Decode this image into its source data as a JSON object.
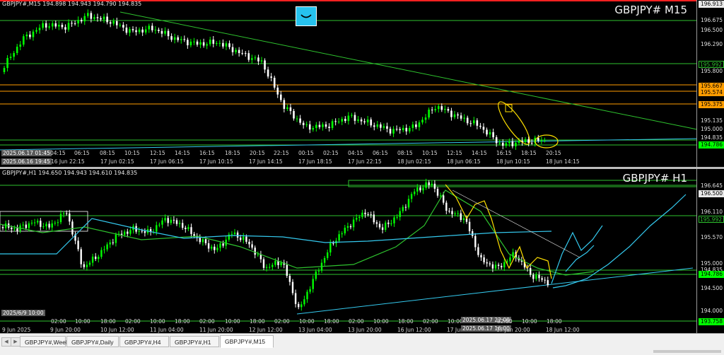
{
  "top_chart": {
    "header": "GBPJPY#,M15  194.898 194.943 194.790 194.835",
    "title": "GBPJPY# M15",
    "price_labels": [
      "196.913",
      "196.675",
      "196.500",
      "196.290",
      "195.992",
      "195.800",
      "195.667",
      "195.574",
      "195.375",
      "195.135",
      "195.000",
      "194.835",
      "194.786"
    ],
    "time_labels": [
      "04:15",
      "06:15",
      "08:15",
      "10:15",
      "12:15",
      "14:15",
      "16:15",
      "18:15",
      "20:15",
      "22:15",
      "00:15",
      "02:15",
      "04:15",
      "06:15",
      "08:15",
      "10:15",
      "12:15",
      "14:15",
      "16:15",
      "18:15",
      "20:15"
    ],
    "date_labels": [
      "16 Jun 22:15",
      "17 Jun 02:15",
      "17 Jun 06:15",
      "17 Jun 10:15",
      "17 Jun 14:15",
      "17 Jun 18:15",
      "17 Jun 22:15",
      "18 Jun 02:15",
      "18 Jun 06:15",
      "18 Jun 10:15",
      "18 Jun 14:15"
    ],
    "crosshair_time": "2025.06.17 01:45",
    "crosshair_date": "2025.06.16 19:45"
  },
  "bottom_chart": {
    "header": "GBPJPY#,H1  194.650 194.943 194.610 194.835",
    "title": "GBPJPY# H1",
    "price_labels": [
      "196.645",
      "196.500",
      "196.110",
      "195.992",
      "195.570",
      "195.000",
      "194.835",
      "194.786",
      "194.500",
      "194.000",
      "193.758"
    ],
    "date_labels": [
      "9 Jun 2025",
      "9 Jun 20:00",
      "10 Jun 12:00",
      "11 Jun 04:00",
      "11 Jun 20:00",
      "12 Jun 12:00",
      "13 Jun 04:00",
      "13 Jun 20:00",
      "16 Jun 12:00",
      "17 Jun 04:00",
      "17 Jun 20:00",
      "18 Jun 12:00"
    ],
    "time_labels": [
      "02:00",
      "10:00",
      "18:00",
      "02:00",
      "10:00",
      "18:00",
      "02:00",
      "10:00",
      "18:00",
      "02:00",
      "10:00",
      "18:00",
      "02:00",
      "10:00",
      "18:00",
      "02:00",
      "10:00",
      "18:00",
      "02:00",
      "10:00",
      "18:00"
    ],
    "crosshair_time": "2025.06.17 22:00",
    "crosshair_date": "2025.06.17 16:00",
    "left_time": "2025/6/9 10:00"
  },
  "tabs": [
    "GBPJPY#,Weekly",
    "GBPJPY#,Daily",
    "GBPJPY#,H4",
    "GBPJPY#,H1",
    "GBPJPY#,M15"
  ],
  "active_tab": "GBPJPY#,M15",
  "colors": {
    "background": "#000000",
    "bull": "#00ff00",
    "bear": "#ffffff",
    "level_green": "#2ec22e",
    "level_orange": "#ff9d00",
    "ma_cyan": "#34c9ee",
    "annotation_yellow": "#ffe000"
  }
}
